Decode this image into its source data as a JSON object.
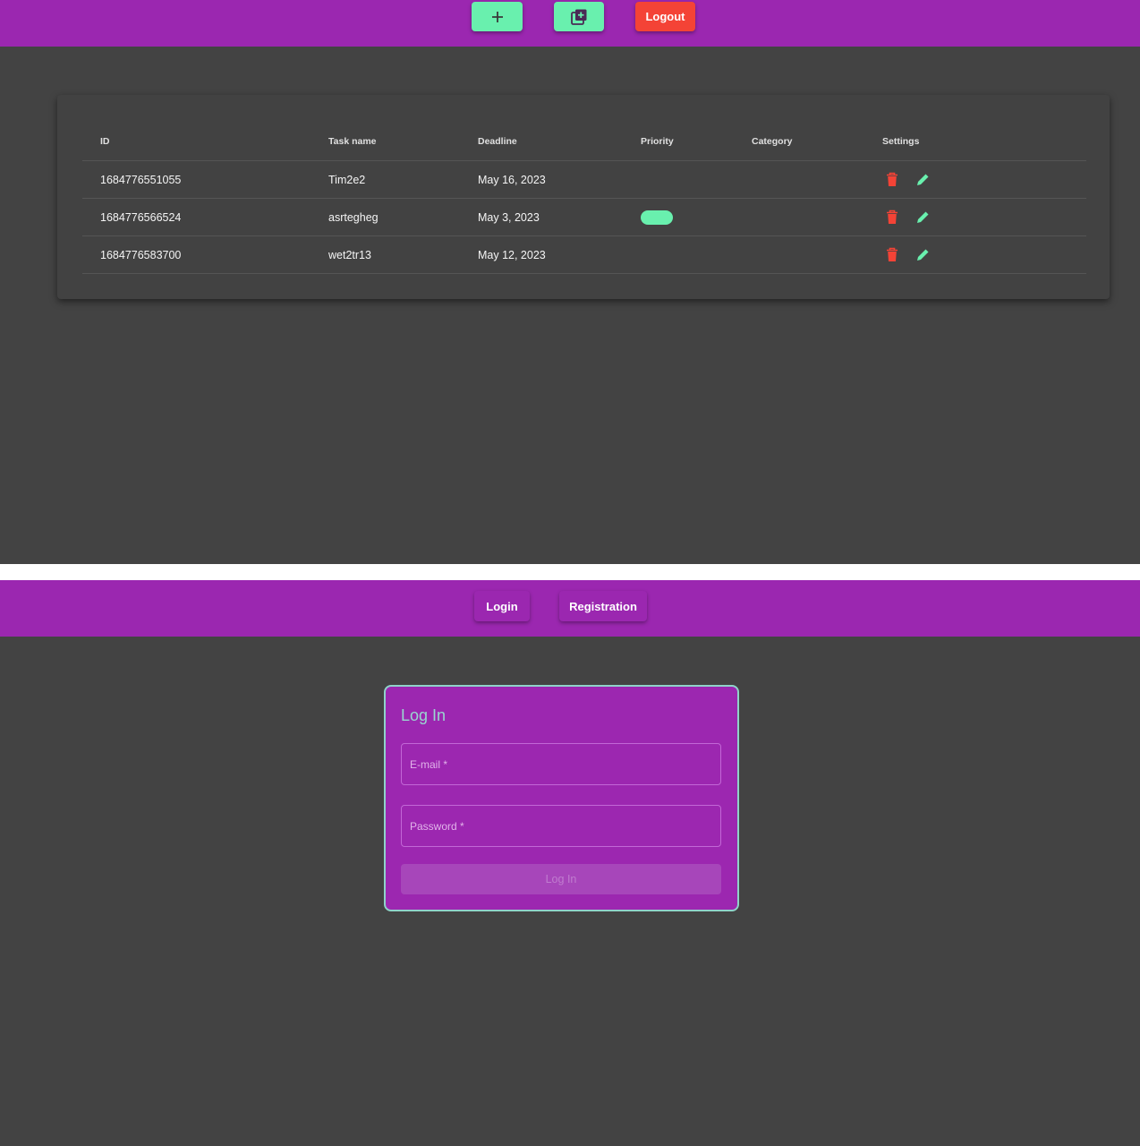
{
  "tasks_view": {
    "toolbar": {
      "add_icon": "plus-icon",
      "add_category_icon": "library-add-icon",
      "logout_label": "Logout"
    },
    "table": {
      "columns": [
        "ID",
        "Task name",
        "Deadline",
        "Priority",
        "Category",
        "Settings"
      ],
      "rows": [
        {
          "id": "1684776551055",
          "name": "Tim2e2",
          "deadline": "May 16, 2023",
          "priority": false
        },
        {
          "id": "1684776566524",
          "name": "asrtegheg",
          "deadline": "May 3, 2023",
          "priority": true
        },
        {
          "id": "1684776583700",
          "name": "wet2tr13",
          "deadline": "May 12, 2023",
          "priority": false
        }
      ],
      "row_actions": [
        "delete-icon",
        "edit-icon"
      ]
    },
    "colors": {
      "appbar": "#9b27b0",
      "accent": "#69f0ae",
      "danger": "#f44336",
      "background": "#434343"
    }
  },
  "login_view": {
    "nav": {
      "login_label": "Login",
      "registration_label": "Registration"
    },
    "form": {
      "title": "Log In",
      "email_label": "E-mail *",
      "password_label": "Password *",
      "submit_label": "Log In"
    }
  }
}
